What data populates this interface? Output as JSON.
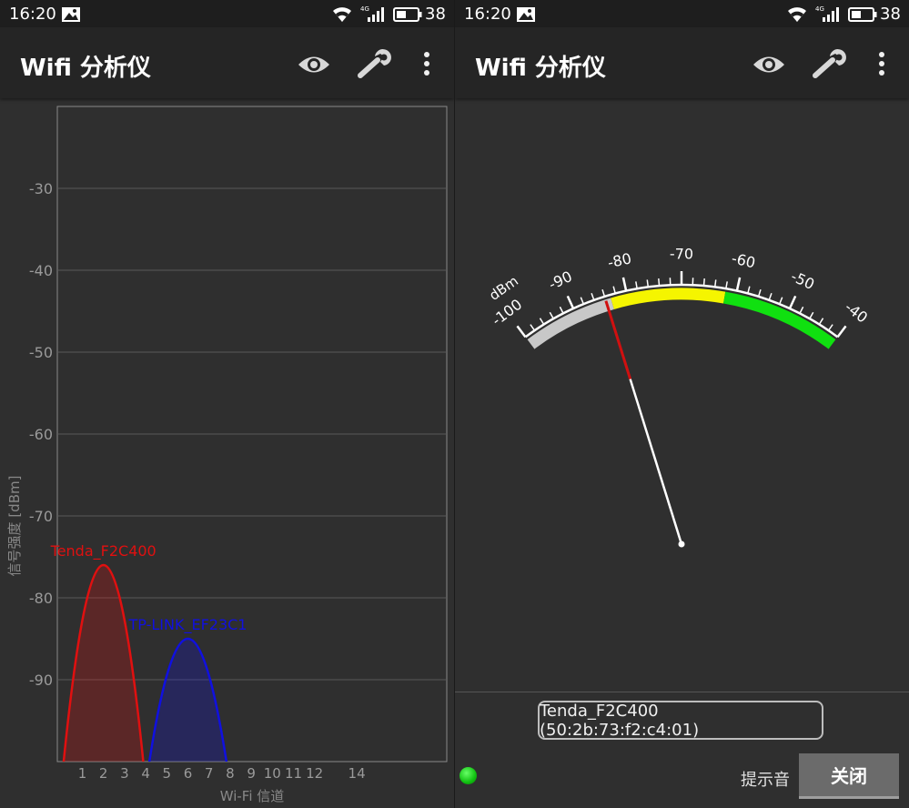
{
  "status": {
    "time": "16:20",
    "battery": "38",
    "network": "4G"
  },
  "app": {
    "title": "Wifi 分析仪"
  },
  "chart_data": [
    {
      "type": "area",
      "ylabel": "信号强度 [dBm]",
      "xlabel": "Wi-Fi 信道",
      "ylim": [
        -100,
        -20
      ],
      "yticks": [
        "-30",
        "-40",
        "-50",
        "-60",
        "-70",
        "-80",
        "-90"
      ],
      "xticks": [
        "1",
        "2",
        "3",
        "4",
        "5",
        "6",
        "7",
        "8",
        "9",
        "10",
        "11",
        "12",
        "14"
      ],
      "grid": true,
      "series": [
        {
          "name": "Tenda_F2C400",
          "channel": 2,
          "peak": -76,
          "color": "#e01010"
        },
        {
          "name": "TP-LINK_EF23C1",
          "channel": 6,
          "peak": -85,
          "color": "#1010e0"
        }
      ]
    },
    {
      "type": "gauge",
      "unit": "dBm",
      "range": [
        -100,
        -40
      ],
      "labels": [
        "-100",
        "-90",
        "-80",
        "-70",
        "-60",
        "-50",
        "-40"
      ],
      "bands": [
        {
          "from": -100,
          "to": -83,
          "color": "#c8c8c8"
        },
        {
          "from": -83,
          "to": -62,
          "color": "#f5f500"
        },
        {
          "from": -62,
          "to": -40,
          "color": "#10e010"
        }
      ],
      "value": -84
    }
  ],
  "selected_ap": "Tenda_F2C400 (50:2b:73:f2:c4:01)",
  "tone_label": "提示音",
  "close_label": "关闭",
  "colors": {
    "background": "#2f2f2f",
    "appbar": "#252525",
    "accent_red": "#e01010",
    "accent_blue": "#1010e0"
  }
}
